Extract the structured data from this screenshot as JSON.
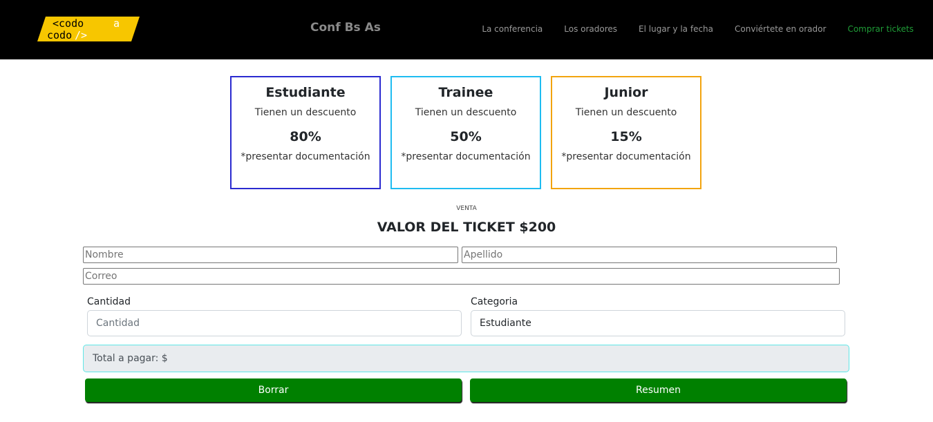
{
  "nav": {
    "logo_alt": "codoacodo",
    "brand": "Conf Bs As",
    "links": [
      {
        "label": "La conferencia"
      },
      {
        "label": "Los oradores"
      },
      {
        "label": "El lugar y la fecha"
      },
      {
        "label": "Conviértete en orador"
      },
      {
        "label": "Comprar tickets"
      }
    ],
    "active_color": "#1f9d37"
  },
  "cards": [
    {
      "title": "Estudiante",
      "subtitle": "Tienen un descuento",
      "discount": "80%",
      "note": "*presentar documentación",
      "border_color": "#2a2ad0"
    },
    {
      "title": "Trainee",
      "subtitle": "Tienen un descuento",
      "discount": "50%",
      "note": "*presentar documentación",
      "border_color": "#1ebcf1"
    },
    {
      "title": "Junior",
      "subtitle": "Tienen un descuento",
      "discount": "15%",
      "note": "*presentar documentación",
      "border_color": "#f2a40f"
    }
  ],
  "sale": {
    "overline": "VENTA",
    "title": "VALOR DEL TICKET $200"
  },
  "form": {
    "nombre_placeholder": "Nombre",
    "apellido_placeholder": "Apellido",
    "correo_placeholder": "Correo",
    "cantidad_label": "Cantidad",
    "cantidad_placeholder": "Cantidad",
    "categoria_label": "Categoria",
    "categoria_value": "Estudiante",
    "total_text": "Total a pagar: $"
  },
  "buttons": {
    "borrar": "Borrar",
    "resumen": "Resumen",
    "color": "#008000"
  }
}
